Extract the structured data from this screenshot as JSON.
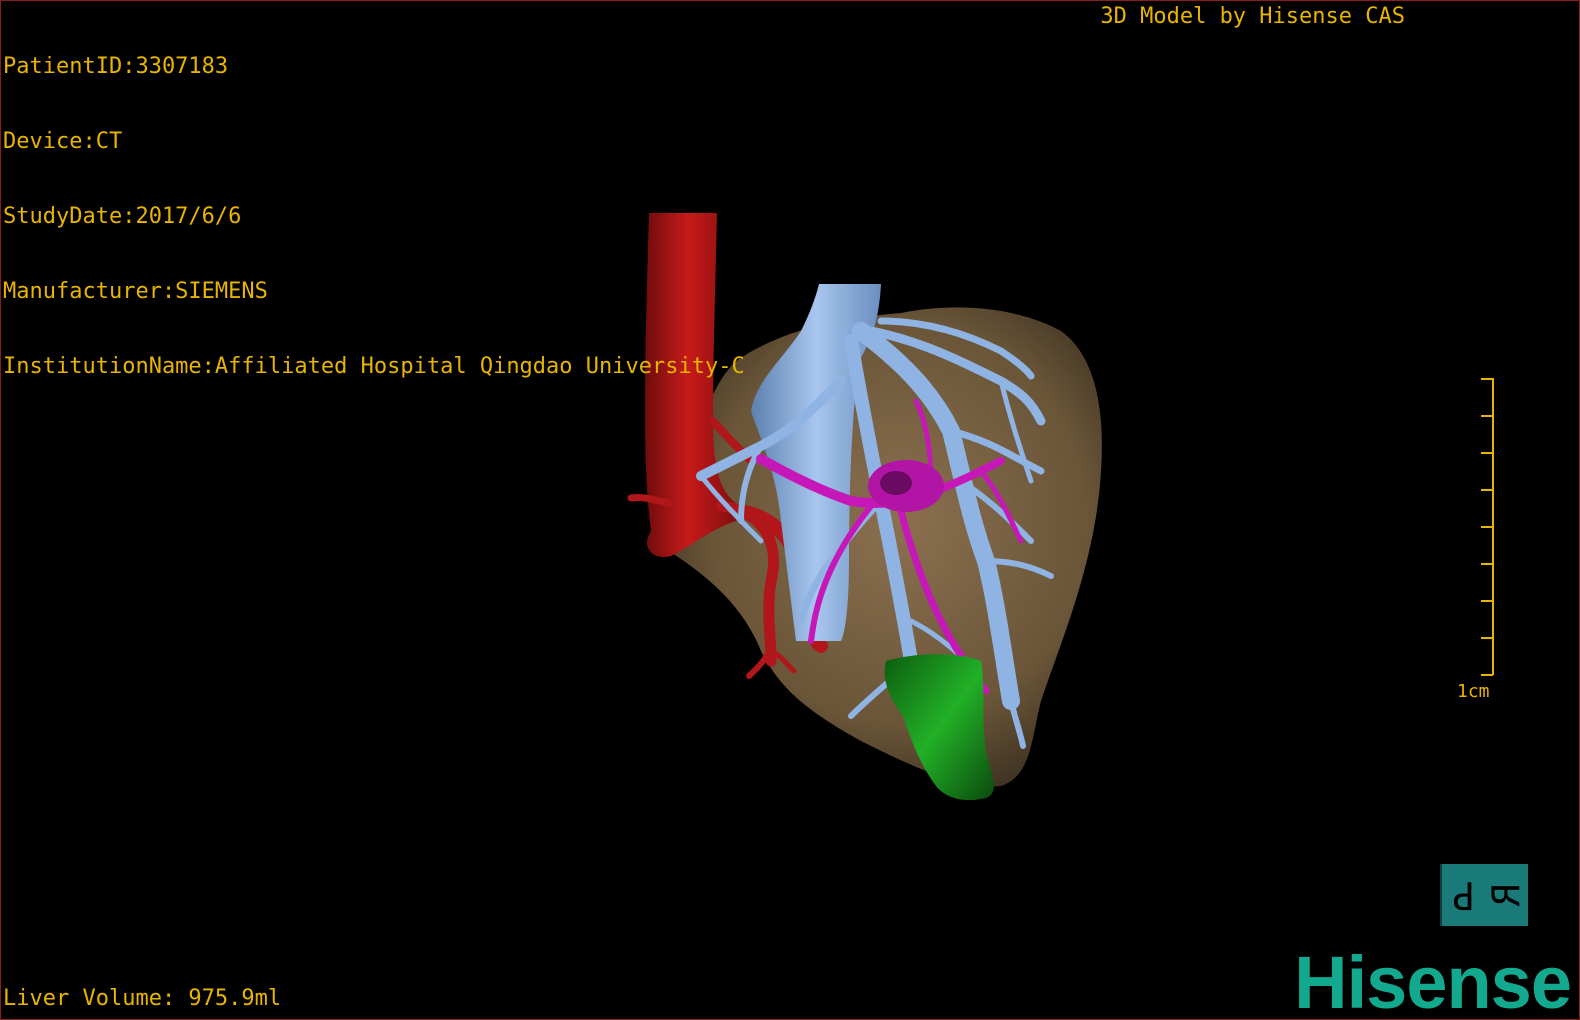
{
  "overlay": {
    "patient_id": "PatientID:3307183",
    "device": "Device:CT",
    "study_date": "StudyDate:2017/6/6",
    "manufacturer": "Manufacturer:SIEMENS",
    "institution": "InstitutionName:Affiliated Hospital Qingdao University-C",
    "brand_text": "3D Model by Hisense CAS",
    "liver_volume": "Liver Volume: 975.9ml"
  },
  "scale_bar": {
    "label": "1cm",
    "ticks": 9
  },
  "orientation_cube": {
    "left_glyph": "P",
    "right_glyph": "R"
  },
  "logo": {
    "text": "Hisense"
  },
  "model_colors": {
    "liver": "#6f5a3c",
    "artery": "#b0161a",
    "hepatic_vein": "#7fa8d8",
    "portal_vein": "#c618b8",
    "gallbladder": "#14801a"
  }
}
